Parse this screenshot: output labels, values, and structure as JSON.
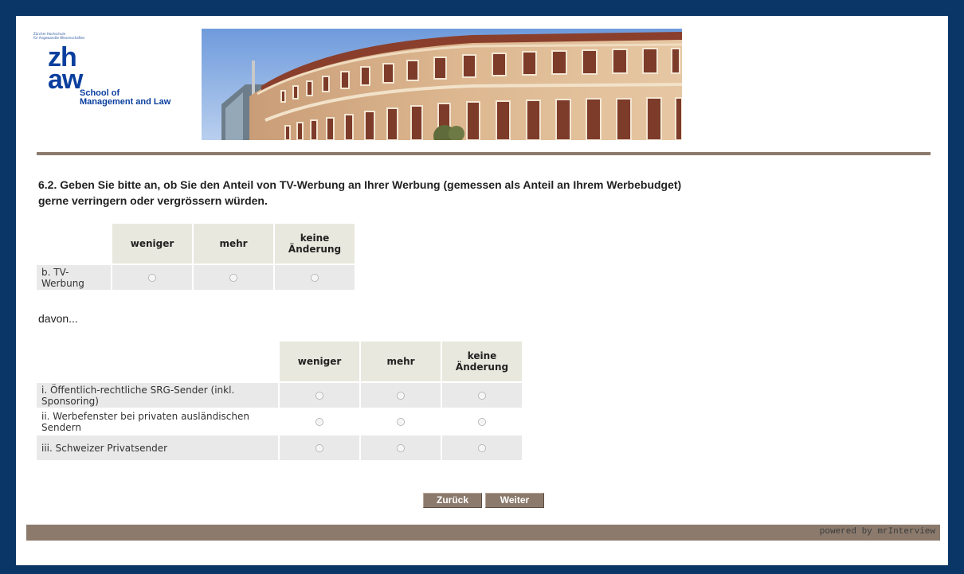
{
  "header": {
    "logo_small_text_1": "Zürcher Hochschule",
    "logo_small_text_2": "für Angewandte Wissenschaften",
    "logo_zh": "zh",
    "logo_aw": "aw",
    "school_line1": "School of",
    "school_line2": "Management and Law"
  },
  "question": {
    "line1": "6.2. Geben Sie bitte an, ob Sie den Anteil von TV-Werbung an Ihrer Werbung (gemessen als Anteil an Ihrem Werbebudget)",
    "line2": "gerne verringern oder vergrössern würden."
  },
  "grid1": {
    "columns": [
      "weniger",
      "mehr",
      "keine Änderung"
    ],
    "rows": [
      {
        "label": "b. TV-Werbung"
      }
    ]
  },
  "davon_text": "davon...",
  "grid2": {
    "columns": [
      "weniger",
      "mehr",
      "keine Änderung"
    ],
    "rows": [
      {
        "label": "i. Öffentlich-rechtliche SRG-Sender (inkl. Sponsoring)"
      },
      {
        "label": "ii. Werbefenster bei privaten ausländischen Sendern"
      },
      {
        "label": "iii. Schweizer Privatsender"
      }
    ]
  },
  "nav": {
    "back_label": "Zurück",
    "next_label": "Weiter"
  },
  "footer": {
    "powered_by": "powered by mrInterview"
  },
  "colors": {
    "frame": "#0a3567",
    "accent": "#8c7b6d",
    "header_cell": "#e9e8de",
    "row_shade": "#e9e9e9",
    "logo_blue": "#0a3f9e"
  }
}
